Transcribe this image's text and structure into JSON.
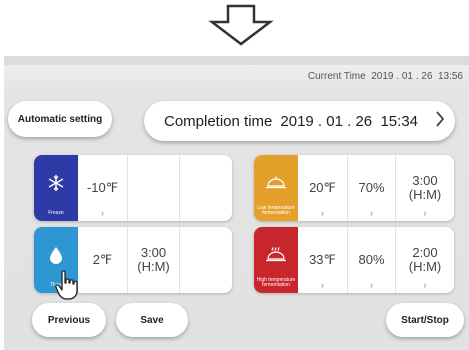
{
  "header": {
    "current_time_label": "Current Time",
    "current_time_value": "2019 . 01 . 26  13:56"
  },
  "automatic_setting": {
    "label": "Automatic setting"
  },
  "completion": {
    "label": "Completion time",
    "value": "2019 . 01 . 26  15:34",
    "chevron": "›"
  },
  "modes": {
    "freeze": {
      "label": "Freeze",
      "icon": "snowflake-icon",
      "color": "#2e3aa6",
      "temperature": "-10℉",
      "arrow": "›"
    },
    "thaw": {
      "label": "Thaw",
      "icon": "droplet-icon",
      "color": "#2e97d3",
      "temperature": "2℉",
      "time": "3:00\n(H:M)"
    },
    "low_temp_fermentation": {
      "label": "Low temperature fermentation",
      "icon": "dough-icon",
      "color": "#e3a02a",
      "temperature": "20℉",
      "humidity": "70%",
      "time": "3:00\n(H:M)",
      "arrow": "›"
    },
    "high_temp_fermentation": {
      "label": "High temperature fermentation",
      "icon": "dough-steam-icon",
      "color": "#c8262d",
      "temperature": "33℉",
      "humidity": "80%",
      "time": "2:00\n(H:M)",
      "arrow": "›"
    }
  },
  "buttons": {
    "previous": "Previous",
    "save": "Save",
    "start_stop": "Start/Stop"
  }
}
